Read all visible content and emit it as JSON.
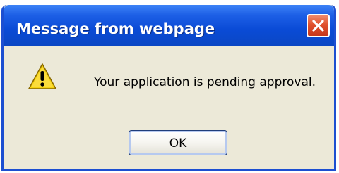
{
  "dialog": {
    "title": "Message from webpage",
    "close_icon": "close-icon",
    "warning_icon": "warning-icon",
    "message": "Your application is pending approval.",
    "ok_label": "OK"
  },
  "colors": {
    "title_bar": "#0a4bd6",
    "close_button": "#e0502c",
    "dialog_background": "#ece9d8",
    "warning_yellow": "#f5d20f"
  }
}
